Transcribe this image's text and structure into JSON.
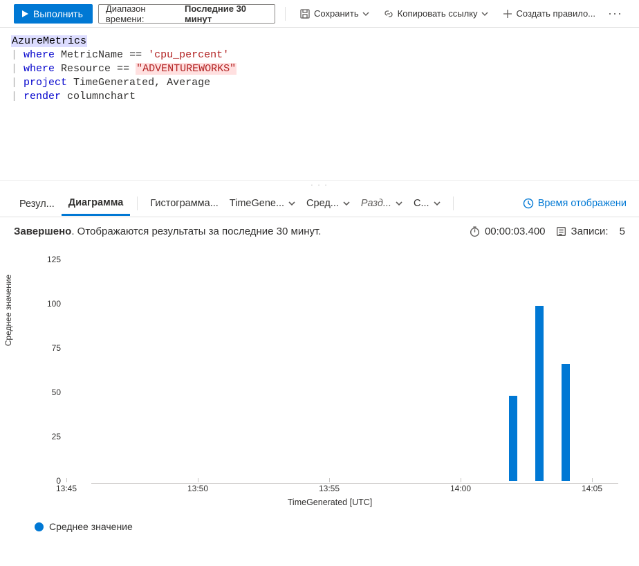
{
  "toolbar": {
    "run_label": "Выполнить",
    "time_range_prefix": "Диапазон времени:",
    "time_range_value": "Последние 30 минут",
    "save_label": "Сохранить",
    "copy_link_label": "Копировать ссылку",
    "create_rule_label": "Создать правило..."
  },
  "editor": {
    "table": "AzureMetrics",
    "lines": [
      {
        "kw": "where",
        "rest": " MetricName == ",
        "str": "'cpu_percent'",
        "cls": "tok-str1"
      },
      {
        "kw": "where",
        "rest": " Resource == ",
        "str": "\"ADVENTUREWORKS\"",
        "cls": "tok-str2"
      },
      {
        "kw": "project",
        "rest": " TimeGenerated, Average"
      },
      {
        "kw": "render",
        "rest": " columnchart"
      }
    ]
  },
  "tabs": {
    "results": "Резул...",
    "diagram": "Диаграмма",
    "histogram": "Гистограмма...",
    "time_gen": "TimeGene...",
    "avg": "Сред...",
    "split": "Разд...",
    "s": "С...",
    "display_time": "Время отображени"
  },
  "status": {
    "completed": "Завершено",
    "text": ". Отображаются результаты за последние 30 минут.",
    "duration": "00:00:03.400",
    "records_label": "Записи:",
    "records_value": "5"
  },
  "chart_data": {
    "type": "bar",
    "title": "",
    "xlabel": "TimeGenerated [UTC]",
    "ylabel": "Среднее значение",
    "ylim": [
      0,
      125
    ],
    "y_ticks": [
      0,
      25,
      50,
      75,
      100,
      125
    ],
    "x_ticks": [
      "13:45",
      "13:50",
      "13:55",
      "14:00",
      "14:05"
    ],
    "series": [
      {
        "name": "Среднее значение",
        "color": "#0078d4",
        "points": [
          {
            "x": "14:02",
            "y": 48
          },
          {
            "x": "14:03",
            "y": 99
          },
          {
            "x": "14:04",
            "y": 66
          }
        ]
      }
    ]
  }
}
